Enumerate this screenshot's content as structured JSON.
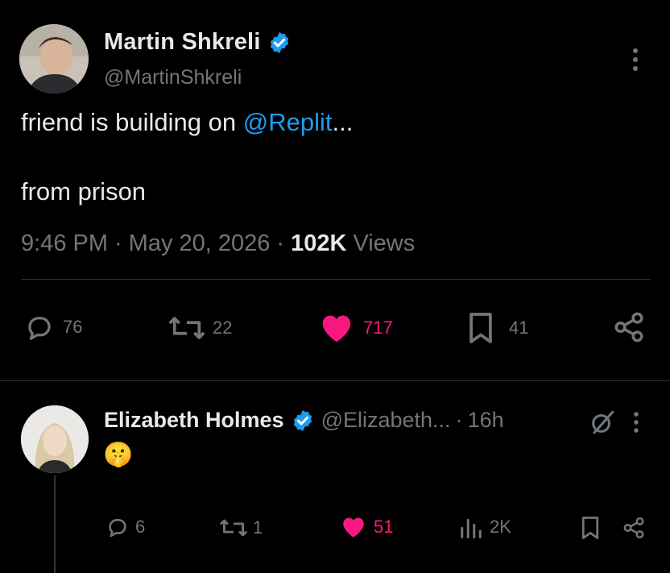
{
  "tweet": {
    "author_name": "Martin Shkreli",
    "author_handle": "@MartinShkreli",
    "text_line1_prefix": "friend is building on ",
    "text_line1_mention": "@Replit",
    "text_line1_suffix": "...",
    "text_line2": "from prison",
    "time": "9:46 PM",
    "date": "May 20, 2026",
    "views_count": "102K",
    "views_label": "Views",
    "replies": "76",
    "retweets": "22",
    "likes": "717",
    "bookmarks": "41",
    "liked": true
  },
  "reply": {
    "author_name": "Elizabeth Holmes",
    "author_handle": "@Elizabeth...",
    "age": "16h",
    "text": "🤫",
    "replies": "6",
    "retweets": "1",
    "likes": "51",
    "views": "2K",
    "liked": true
  },
  "colors": {
    "background": "#000000",
    "text": "#e7e9ea",
    "muted": "#71767b",
    "link": "#1d9bf0",
    "like": "#f91880",
    "verified": "#1d9bf0"
  }
}
